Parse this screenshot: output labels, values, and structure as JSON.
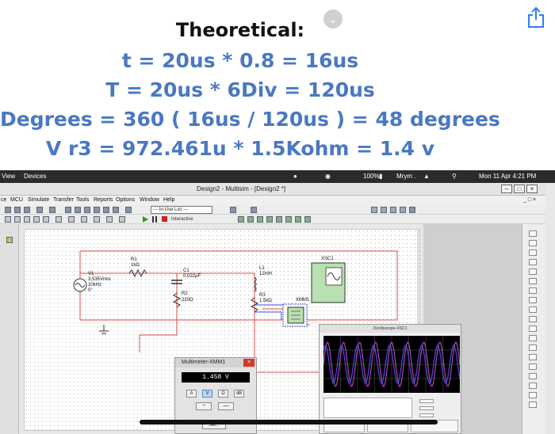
{
  "note": {
    "title": "Theoretical:",
    "equations": [
      "t = 20us * 0.8 = 16us",
      "T = 20us * 6Div = 120us",
      "Degrees = 360 ( 16us / 120us ) = 48 degrees",
      "V r3 = 972.461u * 1.5Kohm = 1.4 v"
    ],
    "text_color": "#4a78c2"
  },
  "os": {
    "left_items": [
      "View",
      "Devices"
    ],
    "battery": "100%",
    "user": "Mrym .",
    "datetime": "Mon 11 Apr  4:21 PM"
  },
  "window": {
    "title": "Design2 - Multisim - [Design2 *]",
    "menu": [
      "ce",
      "MCU",
      "Simulate",
      "Transfer",
      "Tools",
      "Reports",
      "Options",
      "Window",
      "Help"
    ],
    "in_use_list": "--- In-Use List ---",
    "interactive_label": "Interactive"
  },
  "circuit": {
    "v1": {
      "name": "V1",
      "amp": "3.535Vrms",
      "freq": "10kHz",
      "phase": "0°"
    },
    "r1": {
      "name": "R1",
      "value": "1kΩ"
    },
    "c1": {
      "name": "C1",
      "value": "0.022µF"
    },
    "r2": {
      "name": "R2",
      "value": "220Ω"
    },
    "l1": {
      "name": "L1",
      "value": "12mH"
    },
    "r3": {
      "name": "R3",
      "value": "1.5kΩ"
    },
    "xsc1": "XSC1",
    "xmm1": "XMM1"
  },
  "multimeter": {
    "title": "Multimeter-XMM1",
    "reading": "1.458 V",
    "modes": [
      "A",
      "V",
      "Ω",
      "dB"
    ],
    "selected": "V",
    "set_label": "Set..."
  },
  "oscilloscope": {
    "title": "Oscilloscope-XSC1"
  },
  "colors": {
    "wire": "#d94b4b",
    "wire_blue": "#3a4fd0",
    "scope_ch_a": "#b042c0",
    "scope_ch_b": "#4a4fe0"
  }
}
